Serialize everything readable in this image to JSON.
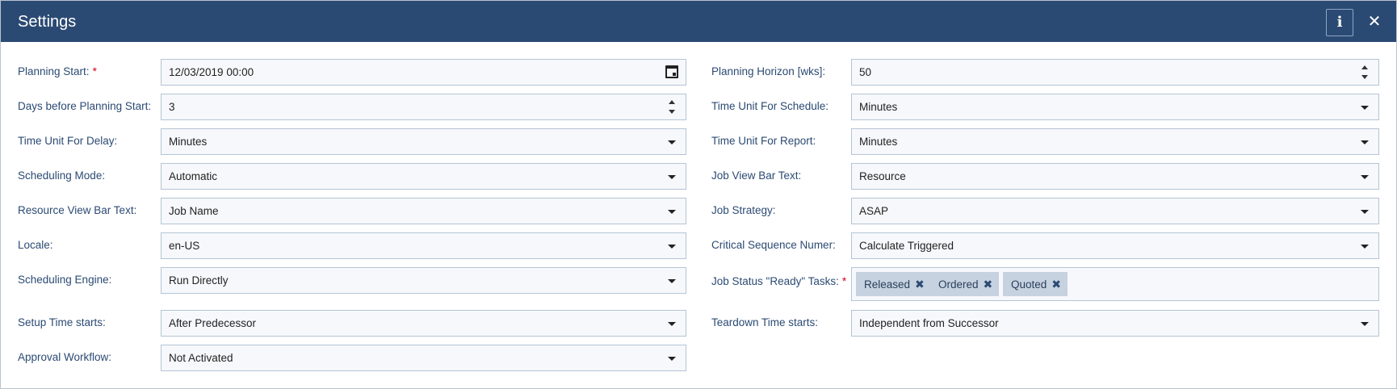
{
  "dialog": {
    "title": "Settings",
    "info_label": "i",
    "close_label": "✕"
  },
  "fields": {
    "planning_start": {
      "label": "Planning Start:",
      "required": "*",
      "value": "12/03/2019 00:00"
    },
    "days_before": {
      "label": "Days before Planning Start:",
      "value": "3"
    },
    "time_unit_delay": {
      "label": "Time Unit For Delay:",
      "value": "Minutes"
    },
    "scheduling_mode": {
      "label": "Scheduling Mode:",
      "value": "Automatic"
    },
    "resource_view_bar_text": {
      "label": "Resource View Bar Text:",
      "value": "Job Name"
    },
    "locale": {
      "label": "Locale:",
      "value": "en-US"
    },
    "scheduling_engine": {
      "label": "Scheduling Engine:",
      "value": "Run Directly"
    },
    "setup_time_starts": {
      "label": "Setup Time starts:",
      "value": "After Predecessor"
    },
    "approval_workflow": {
      "label": "Approval Workflow:",
      "value": "Not Activated"
    },
    "planning_horizon": {
      "label": "Planning Horizon [wks]:",
      "value": "50"
    },
    "time_unit_schedule": {
      "label": "Time Unit For Schedule:",
      "value": "Minutes"
    },
    "time_unit_report": {
      "label": "Time Unit For Report:",
      "value": "Minutes"
    },
    "job_view_bar_text": {
      "label": "Job View Bar Text:",
      "value": "Resource"
    },
    "job_strategy": {
      "label": "Job Strategy:",
      "value": "ASAP"
    },
    "critical_sequence": {
      "label": "Critical Sequence Numer:",
      "value": "Calculate Triggered"
    },
    "job_status_ready": {
      "label": "Job Status \"Ready\" Tasks:",
      "required": "*",
      "tags": [
        "Released",
        "Ordered",
        "Quoted"
      ],
      "remove_glyph": "✖"
    },
    "teardown_time_starts": {
      "label": "Teardown Time starts:",
      "value": "Independent from Successor"
    }
  }
}
